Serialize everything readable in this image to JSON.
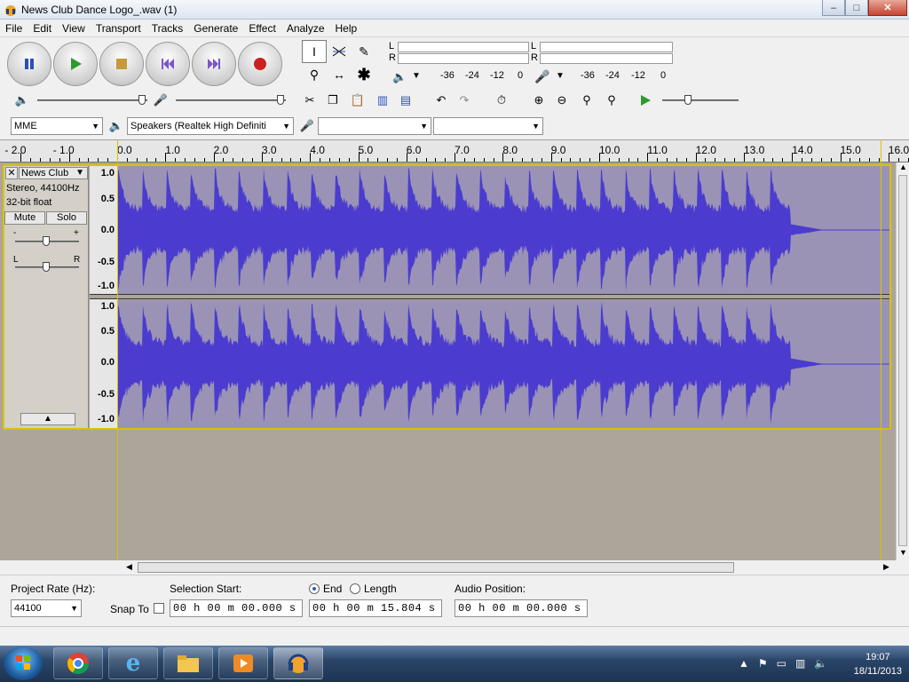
{
  "window": {
    "title": "News Club Dance Logo_.wav (1)",
    "minimize": "–",
    "maximize": "□",
    "close": "✕"
  },
  "menu": [
    "File",
    "Edit",
    "View",
    "Transport",
    "Tracks",
    "Generate",
    "Effect",
    "Analyze",
    "Help"
  ],
  "meters": {
    "left": "L",
    "right": "R",
    "ticks": [
      "-36",
      "-24",
      "-12",
      "0",
      "-36",
      "-24",
      "-12",
      "0"
    ]
  },
  "device": {
    "host": "MME",
    "output": "Speakers (Realtek High Definiti",
    "input": "",
    "channels": ""
  },
  "ruler": [
    "- 2.0",
    "- 1.0",
    "0.0",
    "1.0",
    "2.0",
    "3.0",
    "4.0",
    "5.0",
    "6.0",
    "7.0",
    "8.0",
    "9.0",
    "10.0",
    "11.0",
    "12.0",
    "13.0",
    "14.0",
    "15.0",
    "16.0"
  ],
  "track": {
    "name": "News Club",
    "info1": "Stereo, 44100Hz",
    "info2": "32-bit float",
    "mute": "Mute",
    "solo": "Solo",
    "gain_minus": "-",
    "gain_plus": "+",
    "pan_l": "L",
    "pan_r": "R",
    "collapse": "▲",
    "vruler": [
      "1.0",
      "0.5",
      "0.0",
      "-0.5",
      "-1.0"
    ],
    "audio_end_seconds": 13.95,
    "total_seconds": 15.804
  },
  "selection": {
    "project_rate_label": "Project Rate (Hz):",
    "project_rate": "44100",
    "snap_to": "Snap To",
    "selection_start_label": "Selection Start:",
    "end_label": "End",
    "length_label": "Length",
    "audio_position_label": "Audio Position:",
    "start_value": "00 h 00 m 00.000 s",
    "end_value": "00 h 00 m 15.804 s",
    "position_value": "00 h 00 m 00.000 s"
  },
  "taskbar": {
    "time": "19:07",
    "date": "18/11/2013"
  },
  "colors": {
    "waveform": "#4b3ccf",
    "wave_bg": "#9a93b5",
    "selection_edge": "#d8c200",
    "track_bg": "#aba59a"
  }
}
